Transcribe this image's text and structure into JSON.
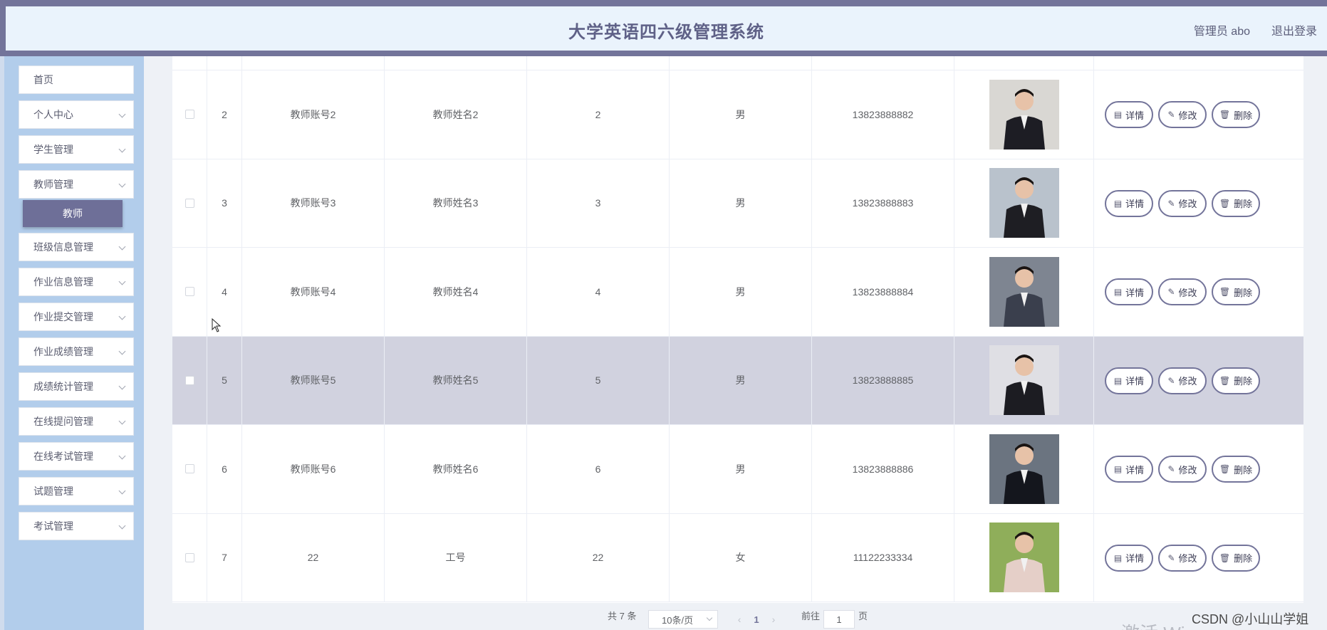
{
  "header": {
    "title": "大学英语四六级管理系统",
    "user": "管理员 abo",
    "logout": "退出登录"
  },
  "sidebar": {
    "items": [
      {
        "label": "首页"
      },
      {
        "label": "个人中心"
      },
      {
        "label": "学生管理"
      },
      {
        "label": "教师管理"
      },
      {
        "label": "班级信息管理"
      },
      {
        "label": "作业信息管理"
      },
      {
        "label": "作业提交管理"
      },
      {
        "label": "作业成绩管理"
      },
      {
        "label": "成绩统计管理"
      },
      {
        "label": "在线提问管理"
      },
      {
        "label": "在线考试管理"
      },
      {
        "label": "试题管理"
      },
      {
        "label": "考试管理"
      }
    ],
    "active_sub": "教师"
  },
  "table": {
    "rows": [
      {
        "index": "2",
        "account": "教师账号2",
        "name": "教师姓名2",
        "age": "2",
        "gender": "男",
        "phone": "13823888882"
      },
      {
        "index": "3",
        "account": "教师账号3",
        "name": "教师姓名3",
        "age": "3",
        "gender": "男",
        "phone": "13823888883"
      },
      {
        "index": "4",
        "account": "教师账号4",
        "name": "教师姓名4",
        "age": "4",
        "gender": "男",
        "phone": "13823888884"
      },
      {
        "index": "5",
        "account": "教师账号5",
        "name": "教师姓名5",
        "age": "5",
        "gender": "男",
        "phone": "13823888885"
      },
      {
        "index": "6",
        "account": "教师账号6",
        "name": "教师姓名6",
        "age": "6",
        "gender": "男",
        "phone": "13823888886"
      },
      {
        "index": "7",
        "account": "22",
        "name": "工号",
        "age": "22",
        "gender": "女",
        "phone": "11122233334"
      }
    ],
    "actions": {
      "detail": "详情",
      "edit": "修改",
      "delete": "删除"
    }
  },
  "pagination": {
    "total": "共 7 条",
    "page_size": "10条/页",
    "current": "1",
    "goto_label": "前往",
    "goto_value": "1",
    "page_unit": "页"
  },
  "watermark": "CSDN @小山山学姐",
  "os_overlay": "激活 Wi..."
}
